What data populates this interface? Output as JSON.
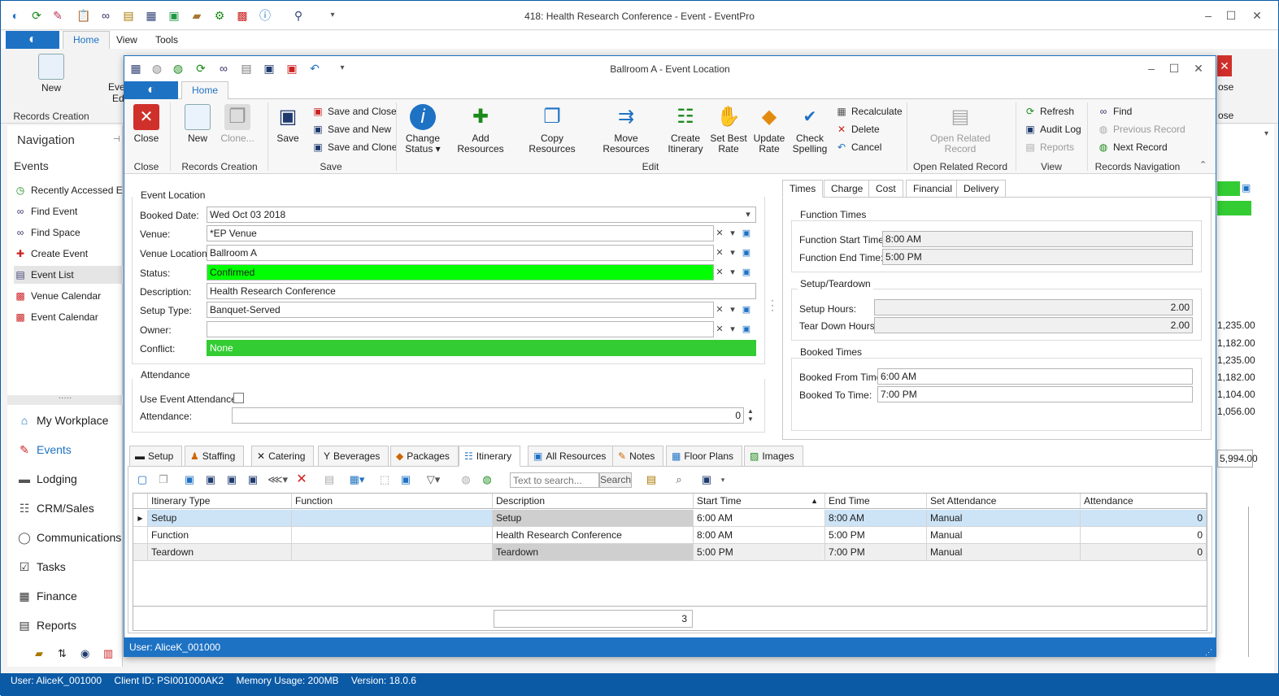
{
  "outer": {
    "title": "418: Health Research Conference - Event - EventPro",
    "tabs": [
      "Home",
      "View",
      "Tools"
    ],
    "ribbon": {
      "new_label": "New",
      "records_creation": "Records Creation",
      "partial_event_label": "Eve",
      "partial_event_label2": "Ed",
      "partial_close": "ose",
      "partial_close2": "ose"
    },
    "nav": {
      "header": "Navigation",
      "section": "Events",
      "items": [
        "Recently Accessed Events",
        "Find Event",
        "Find Space",
        "Create Event",
        "Event List",
        "Venue Calendar",
        "Event Calendar"
      ],
      "workplace": [
        "My Workplace",
        "Events",
        "Lodging",
        "CRM/Sales",
        "Communications",
        "Tasks",
        "Finance",
        "Reports"
      ]
    },
    "right_values": [
      "1,235.00",
      "1,182.00",
      "1,235.00",
      "1,182.00",
      "1,104.00",
      "1,056.00",
      "5,994.00"
    ],
    "status": {
      "user": "User: AliceK_001000",
      "client": "Client ID: PSI001000AK2",
      "memory": "Memory Usage: 200MB",
      "version": "Version: 18.0.6"
    }
  },
  "inner": {
    "title": "Ballroom A - Event Location",
    "tab": "Home",
    "ribbon": {
      "close": "Close",
      "new": "New",
      "clone": "Clone...",
      "save": "Save",
      "save_close": "Save and Close",
      "save_new": "Save and New",
      "save_clone": "Save and Clone",
      "change_status": "Change",
      "change_status2": "Status",
      "add_resources": "Add Resources",
      "copy_resources": "Copy Resources",
      "move_resources": "Move Resources",
      "create_itinerary": "Create",
      "create_itinerary2": "Itinerary",
      "set_best_rate": "Set Best",
      "set_best_rate2": "Rate",
      "update_rate": "Update",
      "update_rate2": "Rate",
      "check_spelling": "Check",
      "check_spelling2": "Spelling",
      "recalculate": "Recalculate",
      "delete": "Delete",
      "cancel": "Cancel",
      "open_related": "Open Related",
      "open_related2": "Record",
      "refresh": "Refresh",
      "audit_log": "Audit Log",
      "reports": "Reports",
      "find": "Find",
      "previous_record": "Previous Record",
      "next_record": "Next Record",
      "groups": {
        "close": "Close",
        "records_creation": "Records Creation",
        "save": "Save",
        "edit": "Edit",
        "open_related": "Open Related Record",
        "view": "View",
        "records_navigation": "Records Navigation"
      }
    },
    "event_location": {
      "group_label": "Event Location",
      "booked_date_label": "Booked Date:",
      "booked_date": "Wed Oct 03 2018",
      "venue_label": "Venue:",
      "venue": "*EP Venue",
      "venue_location_label": "Venue Location:",
      "venue_location": "Ballroom A",
      "status_label": "Status:",
      "status": "Confirmed",
      "description_label": "Description:",
      "description": "Health Research Conference",
      "setup_type_label": "Setup Type:",
      "setup_type": "Banquet-Served",
      "owner_label": "Owner:",
      "owner": "",
      "conflict_label": "Conflict:",
      "conflict": "None"
    },
    "attendance": {
      "group_label": "Attendance",
      "use_label": "Use Event Attendance",
      "attendance_label": "Attendance:",
      "attendance": "0"
    },
    "times_tabs": [
      "Times",
      "Charge",
      "Cost",
      "Financial",
      "Delivery"
    ],
    "function_times": {
      "label": "Function Times",
      "start_label": "Function Start Time:",
      "start": "8:00 AM",
      "end_label": "Function End Time:",
      "end": "5:00 PM"
    },
    "setup_teardown": {
      "label": "Setup/Teardown",
      "setup_label": "Setup Hours:",
      "setup": "2.00",
      "teardown_label": "Tear Down Hours:",
      "teardown": "2.00"
    },
    "booked_times": {
      "label": "Booked Times",
      "from_label": "Booked From Time:",
      "from": "6:00 AM",
      "to_label": "Booked To Time:",
      "to": "7:00 PM"
    },
    "bottom_tabs": [
      "Setup",
      "Staffing",
      "Catering",
      "Beverages",
      "Packages",
      "Itinerary",
      "All Resources",
      "Notes",
      "Floor Plans",
      "Images"
    ],
    "search_placeholder": "Text to search...",
    "search_button": "Search",
    "grid": {
      "columns": [
        "Itinerary Type",
        "Function",
        "Description",
        "Start Time",
        "End Time",
        "Set Attendance",
        "Attendance"
      ],
      "rows": [
        [
          "Setup",
          "",
          "Setup",
          "6:00 AM",
          "8:00 AM",
          "Manual",
          "0"
        ],
        [
          "Function",
          "",
          "Health Research Conference",
          "8:00 AM",
          "5:00 PM",
          "Manual",
          "0"
        ],
        [
          "Teardown",
          "",
          "Teardown",
          "5:00 PM",
          "7:00 PM",
          "Manual",
          "0"
        ]
      ],
      "count": "3"
    },
    "status_user": "User: AliceK_001000"
  },
  "colors": {
    "accent": "#1e72c4",
    "confirmed": "#00ff00",
    "none": "#33cc33"
  }
}
